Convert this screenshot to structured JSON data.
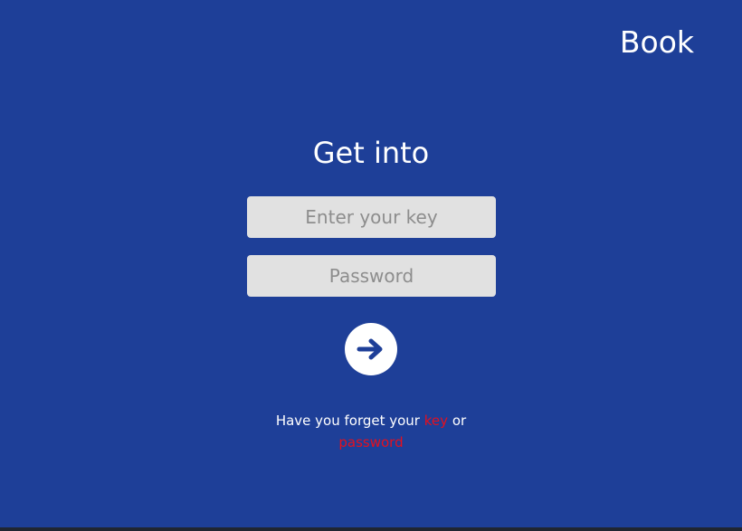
{
  "header": {
    "brand": "Book"
  },
  "login": {
    "title": "Get into",
    "key_placeholder": "Enter your key",
    "password_placeholder": "Password",
    "submit_icon": "arrow-right-icon"
  },
  "help": {
    "prefix": "Have you forget your",
    "key_link": "key",
    "or_text": "or",
    "password_link": "password"
  },
  "colors": {
    "background": "#1e3f98",
    "field_background": "#e1e1e1",
    "link": "#e4101f",
    "text": "#ffffff"
  }
}
